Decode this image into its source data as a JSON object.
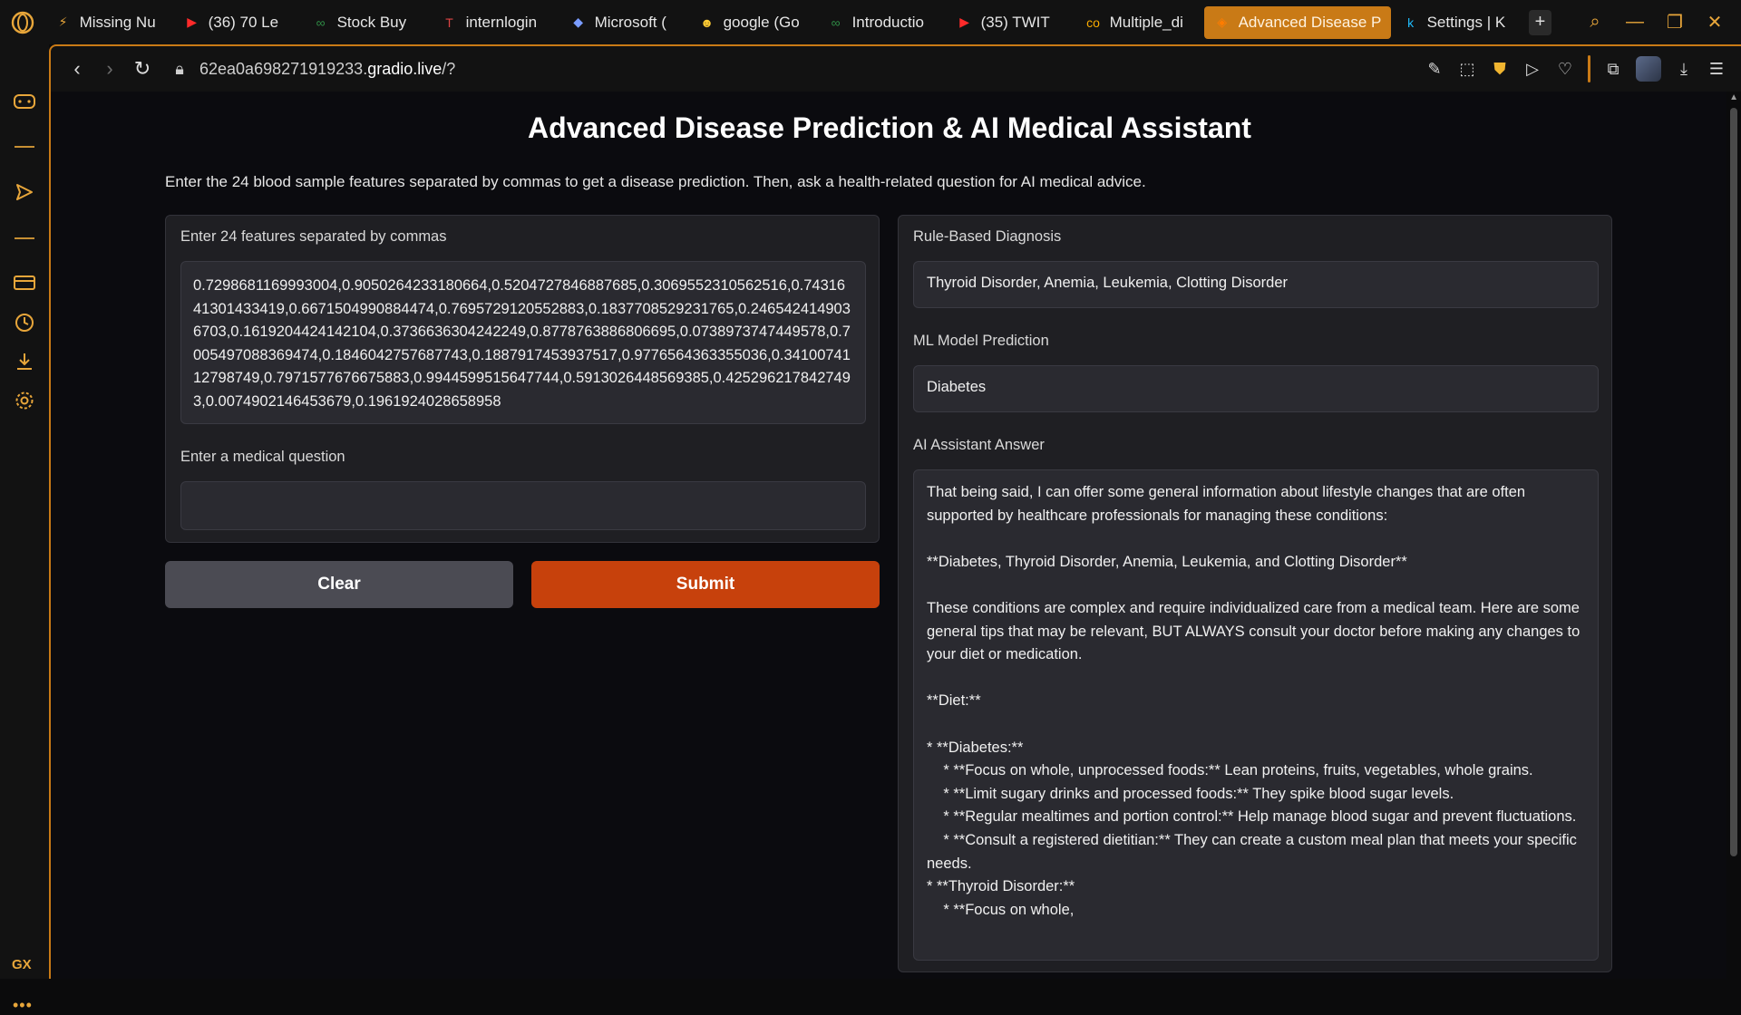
{
  "tabs": [
    {
      "label": "Missing Nu",
      "icon": "bolt-icon",
      "icon_glyph": "⚡"
    },
    {
      "label": "(36) 70 Le",
      "icon": "youtube-icon",
      "icon_glyph": "▶"
    },
    {
      "label": "Stock Buy",
      "icon": "gfg-icon",
      "icon_glyph": "∞"
    },
    {
      "label": "internlogin",
      "icon": "internlogin-icon",
      "icon_glyph": "T"
    },
    {
      "label": "Microsoft (",
      "icon": "copilot-icon",
      "icon_glyph": "◆"
    },
    {
      "label": "google (Go",
      "icon": "huggingface-icon",
      "icon_glyph": "☻"
    },
    {
      "label": "Introductio",
      "icon": "gfg-icon",
      "icon_glyph": "∞"
    },
    {
      "label": "(35) TWIT",
      "icon": "youtube-icon",
      "icon_glyph": "▶"
    },
    {
      "label": "Multiple_di",
      "icon": "colab-icon",
      "icon_glyph": "co"
    },
    {
      "label": "Advanced Disease P",
      "icon": "gradio-icon",
      "icon_glyph": "◈",
      "active": true
    },
    {
      "label": "Settings | K",
      "icon": "kaggle-icon",
      "icon_glyph": "k"
    }
  ],
  "address": {
    "url_host_prefix": "62ea0a698271919233.",
    "url_domain": "gradio.live",
    "url_path": "/?"
  },
  "app": {
    "title": "Advanced Disease Prediction & AI Medical Assistant",
    "description": "Enter the 24 blood sample features separated by commas to get a disease prediction. Then, ask a health-related question for AI medical advice.",
    "features_label": "Enter 24 features separated by commas",
    "features_value": "0.7298681169993004,0.9050264233180664,0.5204727846887685,0.3069552310562516,0.7431641301433419,0.6671504990884474,0.7695729120552883,0.1837708529231765,0.2465424149036703,0.1619204424142104,0.3736636304242249,0.8778763886806695,0.0738973747449578,0.7005497088369474,0.1846042757687743,0.1887917453937517,0.9776564363355036,0.3410074112798749,0.7971577676675883,0.9944599515647744,0.5913026448569385,0.4252962178427493,0.0074902146453679,0.1961924028658958",
    "question_label": "Enter a medical question",
    "question_value": "",
    "clear_label": "Clear",
    "submit_label": "Submit",
    "diagnosis_label": "Rule-Based Diagnosis",
    "diagnosis_value": "Thyroid Disorder, Anemia, Leukemia, Clotting Disorder",
    "ml_label": "ML Model Prediction",
    "ml_value": "Diabetes",
    "answer_label": "AI Assistant Answer",
    "answer_value": "That being said, I can offer some general information about lifestyle changes that are often supported by healthcare professionals for managing these conditions:\n\n**Diabetes, Thyroid Disorder, Anemia, Leukemia, and Clotting Disorder**\n\nThese conditions are complex and require individualized care from a medical team. Here are some general tips that may be relevant, BUT ALWAYS consult your doctor before making any changes to your diet or medication.\n\n**Diet:**\n\n* **Diabetes:**\n    * **Focus on whole, unprocessed foods:** Lean proteins, fruits, vegetables, whole grains.\n    * **Limit sugary drinks and processed foods:** They spike blood sugar levels.\n    * **Regular mealtimes and portion control:** Help manage blood sugar and prevent fluctuations.\n    * **Consult a registered dietitian:** They can create a custom meal plan that meets your specific needs.\n* **Thyroid Disorder:**\n    * **Focus on whole,"
  },
  "sidebar": {
    "gx_label": "GX"
  },
  "colors": {
    "accent": "#c97a16",
    "submit": "#c7410c",
    "clear": "#4b4b53",
    "panel": "#1f1f23"
  }
}
